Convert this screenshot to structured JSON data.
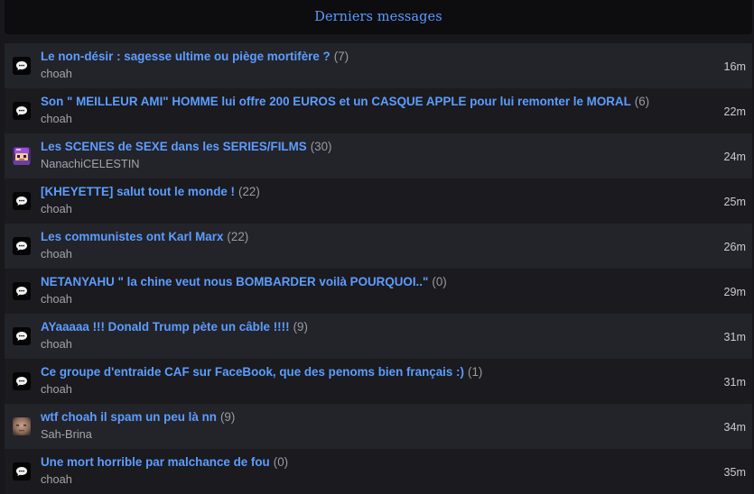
{
  "header": {
    "title": "Derniers messages"
  },
  "messages": [
    {
      "title": "Le non-désir : sagesse ultime ou piège mortifère ?",
      "count": "(7)",
      "author": "choah",
      "time": "16m",
      "avatar": "bubble-icon"
    },
    {
      "title": "Son \" MEILLEUR AMI\" HOMME lui offre 200 EUROS et un CASQUE APPLE pour lui remonter le MORAL",
      "count": "(6)",
      "author": "choah",
      "time": "22m",
      "avatar": "bubble-icon"
    },
    {
      "title": "Les SCENES de SEXE dans les SERIES/FILMS",
      "count": "(30)",
      "author": "NanachiCELESTIN",
      "time": "24m",
      "avatar": "purple-character-avatar"
    },
    {
      "title": "[KHEYETTE] salut tout le monde !",
      "count": "(22)",
      "author": "choah",
      "time": "25m",
      "avatar": "bubble-icon"
    },
    {
      "title": "Les communistes ont Karl Marx",
      "count": "(22)",
      "author": "choah",
      "time": "26m",
      "avatar": "bubble-icon"
    },
    {
      "title": "NETANYAHU \" la chine veut nous BOMBARDER voilà POURQUOI..\"",
      "count": "(0)",
      "author": "choah",
      "time": "29m",
      "avatar": "bubble-icon"
    },
    {
      "title": "AYaaaaa !!! Donald Trump pète un câble !!!!",
      "count": "(9)",
      "author": "choah",
      "time": "31m",
      "avatar": "bubble-icon"
    },
    {
      "title": "Ce groupe d'entraide CAF sur FaceBook, que des penoms bien français :)",
      "count": "(1)",
      "author": "choah",
      "time": "31m",
      "avatar": "bubble-icon"
    },
    {
      "title": "wtf choah il spam un peu là nn",
      "count": "(9)",
      "author": "Sah-Brina",
      "time": "34m",
      "avatar": "photo-avatar"
    },
    {
      "title": "Une mort horrible par malchance de fou",
      "count": "(0)",
      "author": "choah",
      "time": "35m",
      "avatar": "bubble-icon"
    }
  ]
}
